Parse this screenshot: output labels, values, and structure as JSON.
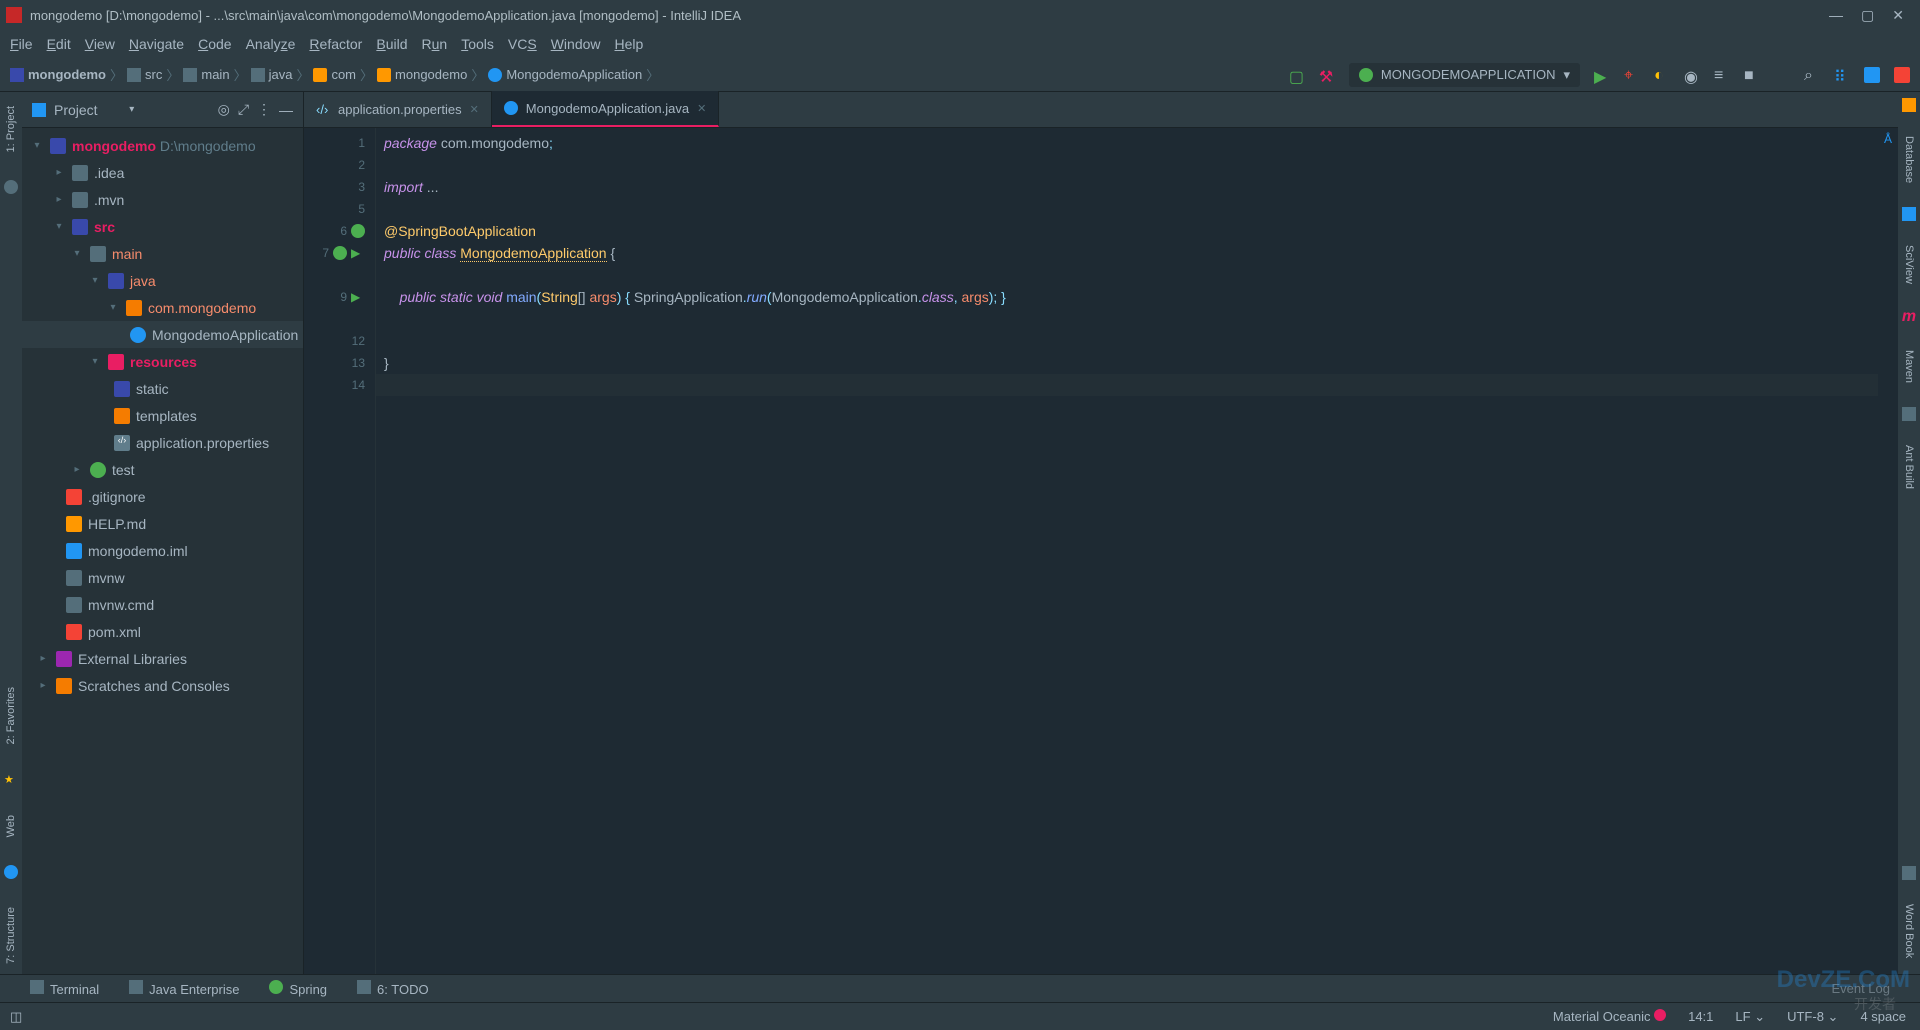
{
  "title": "mongodemo [D:\\mongodemo] - ...\\src\\main\\java\\com\\mongodemo\\MongodemoApplication.java [mongodemo] - IntelliJ IDEA",
  "menu": [
    "File",
    "Edit",
    "View",
    "Navigate",
    "Code",
    "Analyze",
    "Refactor",
    "Build",
    "Run",
    "Tools",
    "VCS",
    "Window",
    "Help"
  ],
  "breadcrumb": [
    "mongodemo",
    "src",
    "main",
    "java",
    "com",
    "mongodemo",
    "MongodemoApplication"
  ],
  "runconfig": "MONGODEMOAPPLICATION",
  "panel": {
    "title": "Project"
  },
  "tree": {
    "root": {
      "name": "mongodemo",
      "path": "D:\\mongodemo"
    },
    "idea": ".idea",
    "mvn": ".mvn",
    "src": "src",
    "main": "main",
    "java": "java",
    "pkg": "com.mongodemo",
    "cls": "MongodemoApplication",
    "res": "resources",
    "static": "static",
    "templates": "templates",
    "prop": "application.properties",
    "test": "test",
    "git": ".gitignore",
    "help": "HELP.md",
    "iml": "mongodemo.iml",
    "mvnw": "mvnw",
    "mvnwcmd": "mvnw.cmd",
    "pom": "pom.xml",
    "ext": "External Libraries",
    "scratch": "Scratches and Consoles"
  },
  "tabs": [
    {
      "name": "application.properties"
    },
    {
      "name": "MongodemoApplication.java"
    }
  ],
  "code": {
    "l1": {
      "kw": "package ",
      "s": "com.mongodemo",
      "semi": ";"
    },
    "l3": {
      "kw": "import ",
      "s": "..."
    },
    "l6": {
      "ann": "@SpringBootApplication"
    },
    "l7": {
      "kw1": "public ",
      "kw2": "class ",
      "cls": "MongodemoApplication",
      "rest": " {"
    },
    "l9a": "    ",
    "l9_pub": "public ",
    "l9_st": "static ",
    "l9_vd": "void ",
    "l9_mn": "main",
    "l9_op": "(",
    "l9_str": "String",
    "l9_br": "[] ",
    "l9_args": "args",
    "l9_cl": ") { ",
    "l9_sa": "SpringApplication",
    "l9_dot": ".",
    "l9_run": "run",
    "l9_op2": "(",
    "l9_c2": "MongodemoApplication",
    "l9_dot2": ".",
    "l9_class": "class",
    "l9_com": ", ",
    "l9_args2": "args",
    "l9_end": "); }",
    "l13": "}"
  },
  "lines": [
    "1",
    "2",
    "3",
    "5",
    "6",
    "7",
    "",
    "9",
    "",
    "12",
    "13",
    "14"
  ],
  "bottom": {
    "terminal": "Terminal",
    "je": "Java Enterprise",
    "spring": "Spring",
    "todo": "6: TODO"
  },
  "right": [
    "Database",
    "SciView",
    "Maven",
    "Ant Build",
    "Word Book"
  ],
  "left": [
    "1: Project",
    "2: Favorites",
    "Web",
    "7: Structure"
  ],
  "status": {
    "theme": "Material Oceanic",
    "pos": "14:1",
    "le": "LF",
    "enc": "UTF-8",
    "ind": "4 space",
    "log": "Event Log"
  },
  "watermark": "DevZE.CoM",
  "wm2": "开发者"
}
